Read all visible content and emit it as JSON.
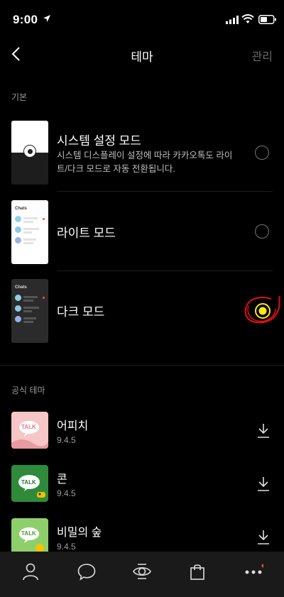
{
  "status": {
    "time": "9:00"
  },
  "nav": {
    "title": "테마",
    "manage": "관리"
  },
  "sections": {
    "basic": "기본",
    "official": "공식 테마"
  },
  "basic_themes": [
    {
      "title": "시스템 설정 모드",
      "desc": "시스템 디스플레이 설정에 따라 카카오톡도 라이트/다크 모드로 자동 전환됩니다.",
      "selected": false
    },
    {
      "title": "라이트 모드",
      "selected": false,
      "thumb_label": "Chats"
    },
    {
      "title": "다크 모드",
      "selected": true,
      "thumb_label": "Chats"
    }
  ],
  "official_themes": [
    {
      "title": "어피치",
      "version": "9.4.5",
      "thumb_text": "TALK"
    },
    {
      "title": "콘",
      "version": "9.4.5",
      "thumb_text": "TALK"
    },
    {
      "title": "비밀의 숲",
      "version": "9.4.5",
      "thumb_text": "TALK"
    }
  ],
  "colors": {
    "accent_yellow": "#ffe812",
    "annotation_red": "#e01010",
    "background": "#000000",
    "tabbar": "#1a1a1a"
  },
  "tabs": [
    "person-icon",
    "chat-bubble-icon",
    "eye-icon",
    "shopping-bag-icon",
    "more-icon"
  ]
}
